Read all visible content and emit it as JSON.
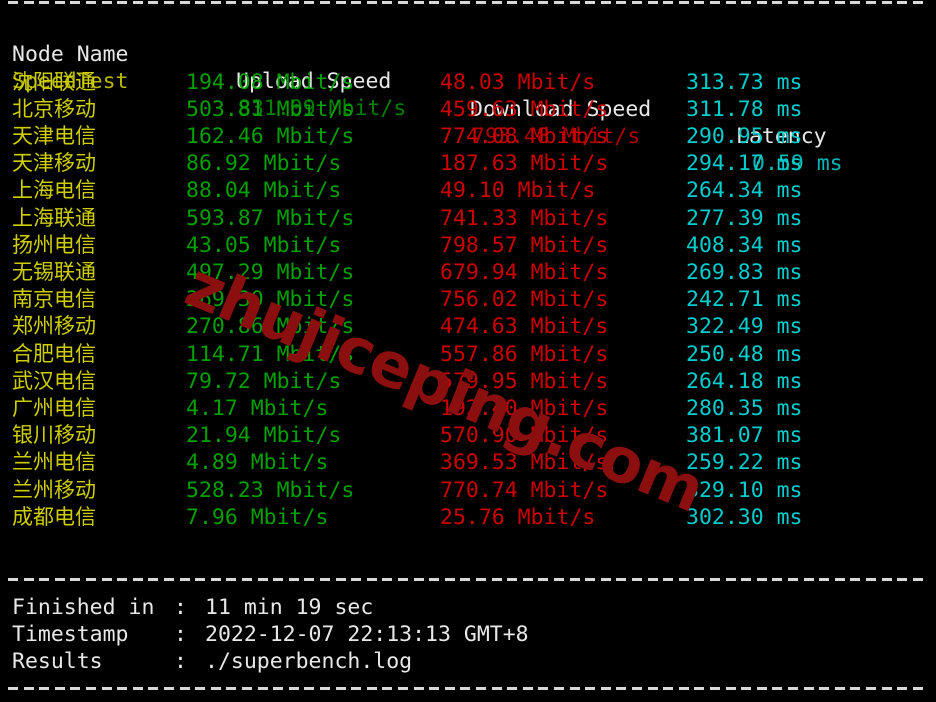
{
  "terminal": {
    "background": "#000000",
    "watermark": "zhujiceping.com",
    "watermark_color": "#8c0f0f"
  },
  "colors": {
    "header": "#e8e8e8",
    "node_name": "#cdcd00",
    "speedtest_label": "#b8b800",
    "upload": "#00a000",
    "download": "#cd0000",
    "latency": "#00cdcd",
    "separator": "#d8d8d8"
  },
  "table": {
    "headers": [
      "Node Name",
      "Upload Speed",
      "Download Speed",
      "Latency"
    ],
    "units": {
      "speed": "Mbit/s",
      "latency": "ms"
    },
    "speedtest_row": {
      "name": "SpeedTest",
      "upload": "831.09 Mbit/s",
      "download": "793.48 Mbit/s",
      "latency": "0.59 ms"
    },
    "rows": [
      {
        "name": "沈阳联通",
        "upload": "194.08 Mbit/s",
        "download": "48.03 Mbit/s",
        "latency": "313.73 ms"
      },
      {
        "name": "北京移动",
        "upload": "503.81 Mbit/s",
        "download": "459.63 Mbit/s",
        "latency": "311.78 ms"
      },
      {
        "name": "天津电信",
        "upload": "162.46 Mbit/s",
        "download": "774.08 Mbit/s",
        "latency": "290.95 ms"
      },
      {
        "name": "天津移动",
        "upload": "86.92 Mbit/s",
        "download": "187.63 Mbit/s",
        "latency": "294.17 ms"
      },
      {
        "name": "上海电信",
        "upload": "88.04 Mbit/s",
        "download": "49.10 Mbit/s",
        "latency": "264.34 ms"
      },
      {
        "name": "上海联通",
        "upload": "593.87 Mbit/s",
        "download": "741.33 Mbit/s",
        "latency": "277.39 ms"
      },
      {
        "name": "扬州电信",
        "upload": "43.05 Mbit/s",
        "download": "798.57 Mbit/s",
        "latency": "408.34 ms"
      },
      {
        "name": "无锡联通",
        "upload": "497.29 Mbit/s",
        "download": "679.94 Mbit/s",
        "latency": "269.83 ms"
      },
      {
        "name": "南京电信",
        "upload": "369.30 Mbit/s",
        "download": "756.02 Mbit/s",
        "latency": "242.71 ms"
      },
      {
        "name": "郑州移动",
        "upload": "270.86 Mbit/s",
        "download": "474.63 Mbit/s",
        "latency": "322.49 ms"
      },
      {
        "name": "合肥电信",
        "upload": "114.71 Mbit/s",
        "download": "557.86 Mbit/s",
        "latency": "250.48 ms"
      },
      {
        "name": "武汉电信",
        "upload": "79.72 Mbit/s",
        "download": "579.95 Mbit/s",
        "latency": "264.18 ms"
      },
      {
        "name": "广州电信",
        "upload": "4.17 Mbit/s",
        "download": "192.40 Mbit/s",
        "latency": "280.35 ms"
      },
      {
        "name": "银川移动",
        "upload": "21.94 Mbit/s",
        "download": "570.90 Mbit/s",
        "latency": "381.07 ms"
      },
      {
        "name": "兰州电信",
        "upload": "4.89 Mbit/s",
        "download": "369.53 Mbit/s",
        "latency": "259.22 ms"
      },
      {
        "name": "兰州移动",
        "upload": "528.23 Mbit/s",
        "download": "770.74 Mbit/s",
        "latency": "329.10 ms"
      },
      {
        "name": "成都电信",
        "upload": "7.96 Mbit/s",
        "download": "25.76 Mbit/s",
        "latency": "302.30 ms"
      }
    ]
  },
  "summary": {
    "items": [
      {
        "label": "Finished in",
        "separator": ":",
        "value": "11 min 19 sec"
      },
      {
        "label": "Timestamp",
        "separator": ":",
        "value": "2022-12-07 22:13:13 GMT+8"
      },
      {
        "label": "Results",
        "separator": ":",
        "value": "./superbench.log"
      }
    ]
  }
}
